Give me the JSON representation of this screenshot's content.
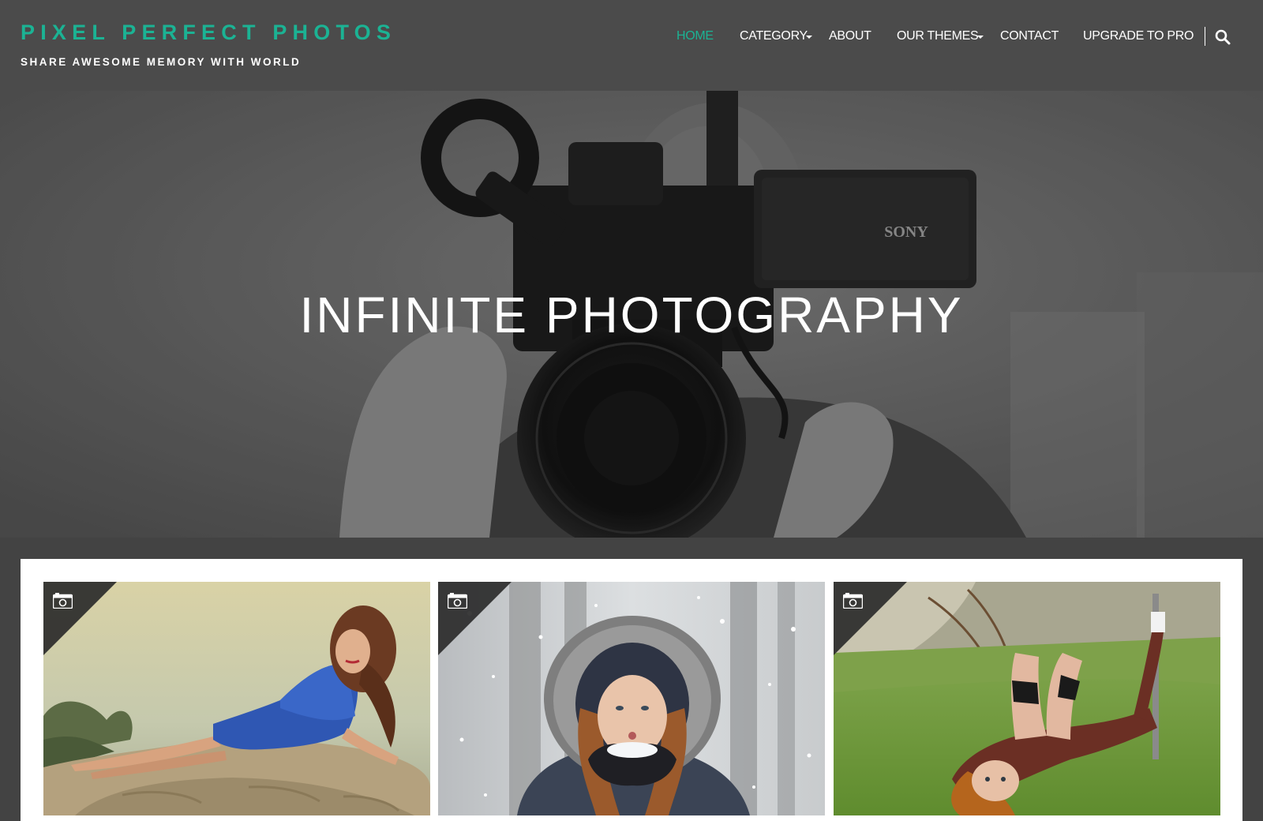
{
  "site": {
    "title": "PIXEL PERFECT PHOTOS",
    "tagline": "SHARE AWESOME MEMORY WITH WORLD"
  },
  "nav": {
    "items": [
      {
        "label": "HOME",
        "active": true,
        "has_dropdown": false
      },
      {
        "label": "CATEGORY",
        "active": false,
        "has_dropdown": true
      },
      {
        "label": "ABOUT",
        "active": false,
        "has_dropdown": false
      },
      {
        "label": "OUR THEMES",
        "active": false,
        "has_dropdown": true
      },
      {
        "label": "CONTACT",
        "active": false,
        "has_dropdown": false
      },
      {
        "label": "UPGRADE TO PRO",
        "active": false,
        "has_dropdown": false
      }
    ],
    "search_icon": "search-icon"
  },
  "hero": {
    "title": "INFINITE PHOTOGRAPHY",
    "camera_brand": "SONY"
  },
  "gallery": {
    "cards": [
      {
        "format_icon": "camera-icon",
        "subject": "woman in blue dress reclining on rocks"
      },
      {
        "format_icon": "camera-icon",
        "subject": "girl in fur hood blowing snow"
      },
      {
        "format_icon": "camera-icon",
        "subject": "woman lying on grass"
      }
    ]
  },
  "colors": {
    "accent": "#1bb394",
    "header_bg": "#4b4b4b",
    "page_bg": "#434343",
    "text_light": "#ffffff"
  }
}
